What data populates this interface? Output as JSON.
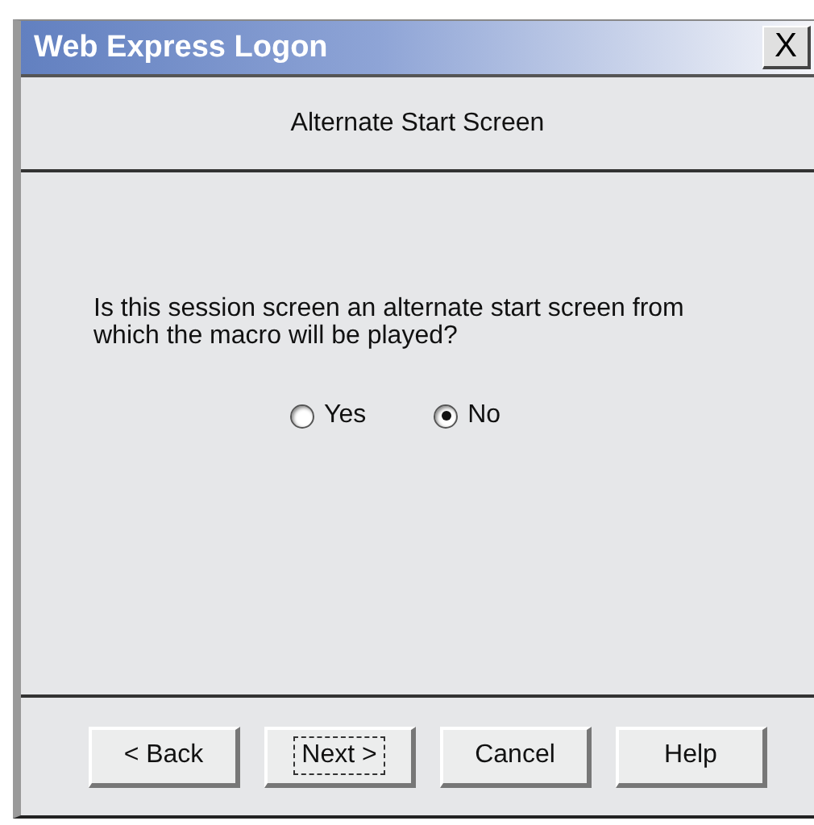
{
  "window": {
    "title": "Web Express Logon",
    "close": "X"
  },
  "header": "Alternate Start Screen",
  "question": "Is this session screen an alternate start screen from which the macro will be played?",
  "options": [
    {
      "label": "Yes",
      "selected": false
    },
    {
      "label": "No",
      "selected": true
    }
  ],
  "buttons": [
    {
      "label": "< Back",
      "focused": false
    },
    {
      "label": "Next >",
      "focused": true
    },
    {
      "label": "Cancel",
      "focused": false
    },
    {
      "label": "Help",
      "focused": false
    }
  ]
}
